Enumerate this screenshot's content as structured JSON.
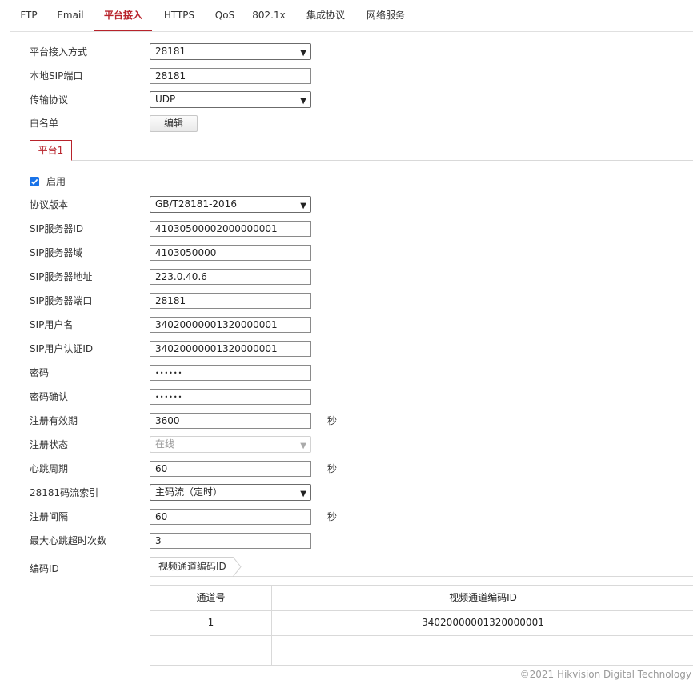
{
  "tabs": [
    "FTP",
    "Email",
    "平台接入",
    "HTTPS",
    "QoS",
    "802.1x",
    "集成协议",
    "网络服务"
  ],
  "active_tab": "平台接入",
  "general": {
    "access_mode": {
      "label": "平台接入方式",
      "value": "28181"
    },
    "local_sip_port": {
      "label": "本地SIP端口",
      "value": "28181"
    },
    "transport": {
      "label": "传输协议",
      "value": "UDP"
    },
    "whitelist": {
      "label": "白名单",
      "button": "编辑"
    }
  },
  "platform_tab": "平台1",
  "enable": {
    "label": "启用",
    "checked": true
  },
  "fields": {
    "protocol_version": {
      "label": "协议版本",
      "value": "GB/T28181-2016"
    },
    "sip_server_id": {
      "label": "SIP服务器ID",
      "value": "41030500002000000001"
    },
    "sip_server_domain": {
      "label": "SIP服务器域",
      "value": "4103050000"
    },
    "sip_server_address": {
      "label": "SIP服务器地址",
      "value": "223.0.40.6"
    },
    "sip_server_port": {
      "label": "SIP服务器端口",
      "value": "28181"
    },
    "sip_username": {
      "label": "SIP用户名",
      "value": "34020000001320000001"
    },
    "sip_auth_id": {
      "label": "SIP用户认证ID",
      "value": "34020000001320000001"
    },
    "password": {
      "label": "密码",
      "value": "••••••"
    },
    "password_confirm": {
      "label": "密码确认",
      "value": "••••••"
    },
    "register_validity": {
      "label": "注册有效期",
      "value": "3600",
      "unit": "秒"
    },
    "register_status": {
      "label": "注册状态",
      "value": "在线"
    },
    "heartbeat_period": {
      "label": "心跳周期",
      "value": "60",
      "unit": "秒"
    },
    "stream_index": {
      "label": "28181码流索引",
      "value": "主码流（定时）"
    },
    "register_interval": {
      "label": "注册间隔",
      "value": "60",
      "unit": "秒"
    },
    "max_heartbeat_timeout": {
      "label": "最大心跳超时次数",
      "value": "3"
    }
  },
  "encoding": {
    "label": "编码ID",
    "tab": "视频通道编码ID",
    "table": {
      "columns": [
        "通道号",
        "视频通道编码ID"
      ],
      "rows": [
        [
          "1",
          "34020000001320000001"
        ]
      ]
    }
  },
  "footer": "©2021 Hikvision Digital Technology",
  "colors": {
    "accent": "#b8232b",
    "checkbox": "#1a73e8"
  }
}
